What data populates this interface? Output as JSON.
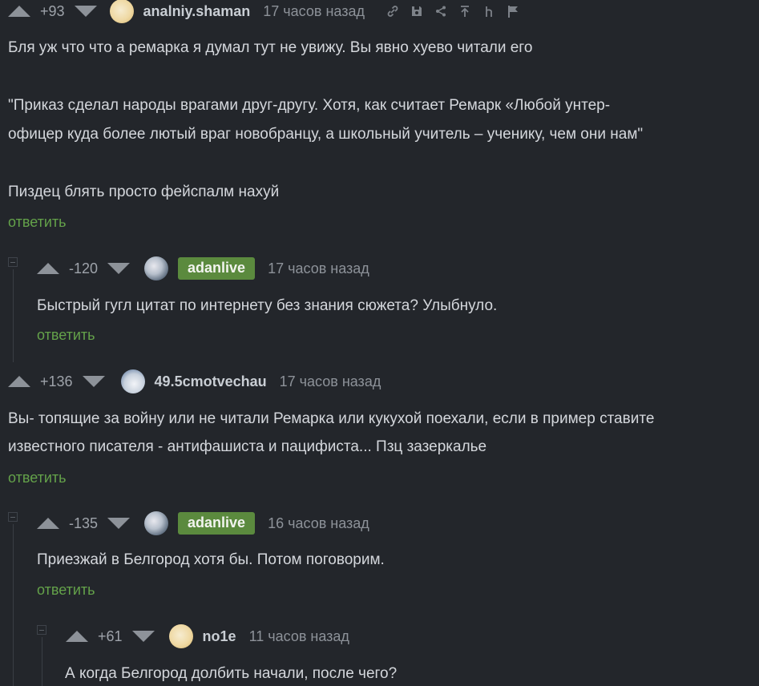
{
  "comments": [
    {
      "score": "+93",
      "username": "analniy.shaman",
      "time": "17 часов назад",
      "lines": [
        "Бля уж что что а ремарка я думал тут не увижу. Вы явно хуево читали его",
        "",
        "\"Приказ сделал народы врагами друг-другу. Хотя, как считает Ремарк «Любой унтер-",
        "офицер куда более лютый враг новобранцу, а школьный учитель – ученику, чем они нам\"",
        "",
        "Пиздец блять просто фейспалм нахуй"
      ],
      "reply": "ответить"
    },
    {
      "score": "-120",
      "username": "adanlive",
      "time": "17 часов назад",
      "lines": [
        "Быстрый гугл цитат по интернету без знания сюжета? Улыбнуло."
      ],
      "reply": "ответить"
    },
    {
      "score": "+136",
      "username": "49.5cmotvechau",
      "time": "17 часов назад",
      "lines": [
        "Вы- топящие за войну или не читали Ремарка или кукухой поехали, если в пример ставите",
        "известного писателя - антифашиста и пацифиста... Пзц зазеркалье"
      ],
      "reply": "ответить"
    },
    {
      "score": "-135",
      "username": "adanlive",
      "time": "16 часов назад",
      "lines": [
        "Приезжай в Белгород хотя бы. Потом поговорим."
      ],
      "reply": "ответить"
    },
    {
      "score": "+61",
      "username": "no1e",
      "time": "11 часов назад",
      "lines": [
        "А когда Белгород долбить начали, после чего?"
      ]
    }
  ],
  "icons": [
    "link-icon",
    "save-icon",
    "share-icon",
    "upload-icon",
    "tag-icon",
    "flag-icon"
  ],
  "colors": {
    "background": "#23262b",
    "reply": "#64a24a",
    "badge": "#5b8a3e"
  }
}
